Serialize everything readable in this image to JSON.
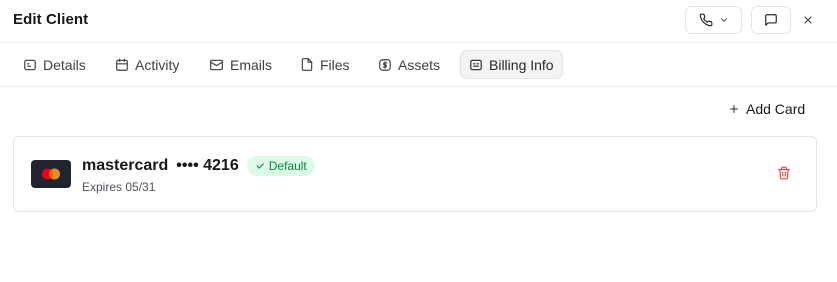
{
  "header": {
    "title": "Edit Client",
    "call_icon": "phone-icon",
    "call_dropdown_icon": "chevron-down-icon",
    "message_icon": "message-square-icon",
    "close_icon": "close-icon"
  },
  "tabs": [
    {
      "label": "Details",
      "icon": "id-card-icon",
      "active": false
    },
    {
      "label": "Activity",
      "icon": "calendar-icon",
      "active": false
    },
    {
      "label": "Emails",
      "icon": "mail-icon",
      "active": false
    },
    {
      "label": "Files",
      "icon": "file-icon",
      "active": false
    },
    {
      "label": "Assets",
      "icon": "dollar-badge-icon",
      "active": false
    },
    {
      "label": "Billing Info",
      "icon": "billing-card-icon",
      "active": true
    }
  ],
  "billing": {
    "add_card_label": "Add Card",
    "cards": [
      {
        "brand": "mastercard",
        "masked_number": "•••• 4216",
        "badge": "Default",
        "expiry": "Expires 05/31"
      }
    ]
  },
  "colors": {
    "accent_green": "#15803d",
    "badge_bg": "#dcfce7",
    "delete_red": "#ef4444",
    "card_logo_bg": "#1f2430",
    "mc_red": "#eb001b",
    "mc_orange": "#f79e1b"
  }
}
